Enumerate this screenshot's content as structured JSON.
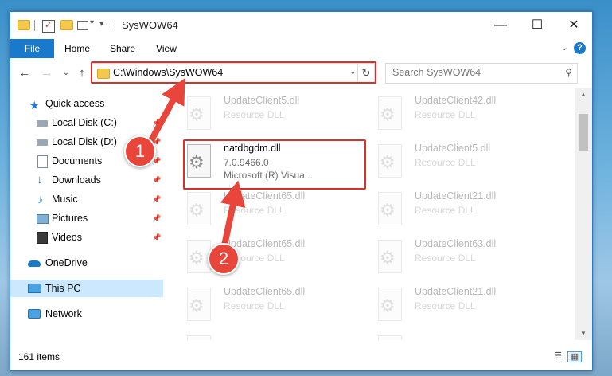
{
  "window": {
    "title": "SysWOW64",
    "minimize_glyph": "—",
    "maximize_glyph": "☐",
    "close_glyph": "✕"
  },
  "ribbon": {
    "tabs": [
      "File",
      "Home",
      "Share",
      "View"
    ],
    "expand_glyph": "⌄",
    "help_glyph": "?"
  },
  "navigation": {
    "back_glyph": "←",
    "forward_glyph": "→",
    "recent_glyph": "⌄",
    "up_glyph": "↑",
    "address": "C:\\Windows\\SysWOW64",
    "address_dropdown_glyph": "⌄",
    "refresh_glyph": "↻",
    "search_placeholder": "Search SysWOW64",
    "search_glyph": "⚲"
  },
  "sidebar": {
    "items": [
      {
        "label": "Quick access",
        "icon": "star-icon",
        "pinned": false
      },
      {
        "label": "Local Disk (C:)",
        "icon": "drive-icon",
        "pinned": true
      },
      {
        "label": "Local Disk (D:)",
        "icon": "drive-icon",
        "pinned": true
      },
      {
        "label": "Documents",
        "icon": "documents-icon",
        "pinned": true
      },
      {
        "label": "Downloads",
        "icon": "download-icon",
        "pinned": true
      },
      {
        "label": "Music",
        "icon": "music-icon",
        "pinned": true
      },
      {
        "label": "Pictures",
        "icon": "pictures-icon",
        "pinned": true
      },
      {
        "label": "Videos",
        "icon": "videos-icon",
        "pinned": true
      },
      {
        "label": "OneDrive",
        "icon": "cloud-icon",
        "pinned": false
      },
      {
        "label": "This PC",
        "icon": "computer-icon",
        "pinned": false,
        "selected": true
      },
      {
        "label": "Network",
        "icon": "network-icon",
        "pinned": false
      }
    ],
    "pin_glyph": "📌"
  },
  "files": {
    "highlighted": {
      "name": "natdbgdm.dll",
      "version": "7.0.9466.0",
      "company": "Microsoft (R) Visua..."
    },
    "left_column": [
      {
        "name": "UpdateClient5.dll",
        "type": "Resource DLL"
      },
      {
        "name": "UpdateClient65.dll",
        "type": "Resource DLL"
      },
      {
        "name": "UpdateClient65.dll",
        "type": "Resource DLL"
      },
      {
        "name": "UpdateClient65.dll",
        "type": "Resource DLL"
      },
      {
        "name": "",
        "type": ""
      }
    ],
    "right_column": [
      {
        "name": "UpdateClient42.dll",
        "type": "Resource DLL"
      },
      {
        "name": "UpdateClient5.dll",
        "type": "Resource DLL"
      },
      {
        "name": "UpdateClient21.dll",
        "type": "Resource DLL"
      },
      {
        "name": "UpdateClient63.dll",
        "type": "Resource DLL"
      },
      {
        "name": "UpdateClient21.dll",
        "type": "Resource DLL"
      },
      {
        "name": "",
        "type": ""
      }
    ]
  },
  "status": {
    "item_count": "161 items"
  },
  "annotations": {
    "step1": "1",
    "step2": "2",
    "color": "#e8463b"
  }
}
